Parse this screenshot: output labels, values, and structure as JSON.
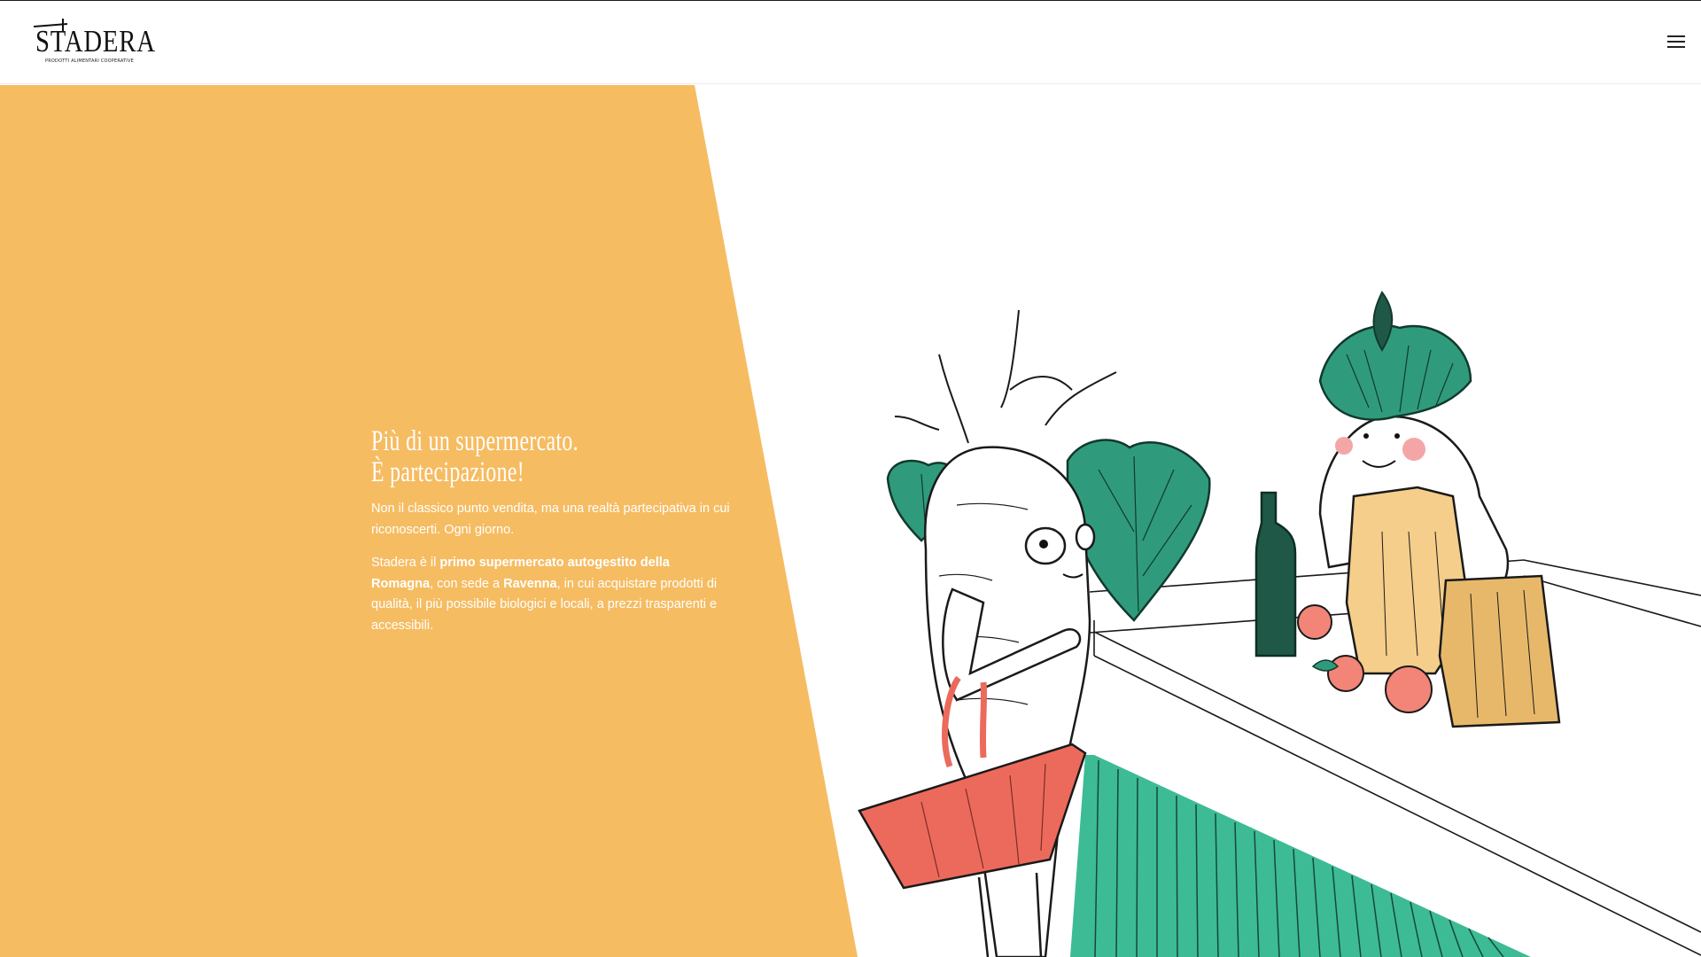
{
  "brand": {
    "logo_text": "STADERA",
    "logo_tagline": "PRODOTTI ALIMENTARI COOPERATIVE"
  },
  "header": {
    "menu_icon": "hamburger-menu-icon"
  },
  "hero": {
    "title_line1": "Più di un supermercato.",
    "title_line2": "È partecipazione!",
    "paragraph1": "Non il classico punto vendita, ma una realtà partecipativa in cui riconoscerti. Ogni giorno.",
    "paragraph2": {
      "t1": "Stadera è il ",
      "b1": "primo supermercato autogestito della Romagna",
      "t2": ", con sede a ",
      "b2": "Ravenna",
      "t3": ", in cui acquistare prodotti di qualità, il più possibile biologici e locali, a prezzi trasparenti e accessibili."
    }
  },
  "colors": {
    "orange": "#F6BC62",
    "teal": "#3DBB95",
    "dark_green": "#1F5846",
    "coral": "#EC6A5C",
    "paper_bag": "#F4CE8A",
    "header_bg": "#FFFFFF",
    "text_dark": "#111111"
  }
}
